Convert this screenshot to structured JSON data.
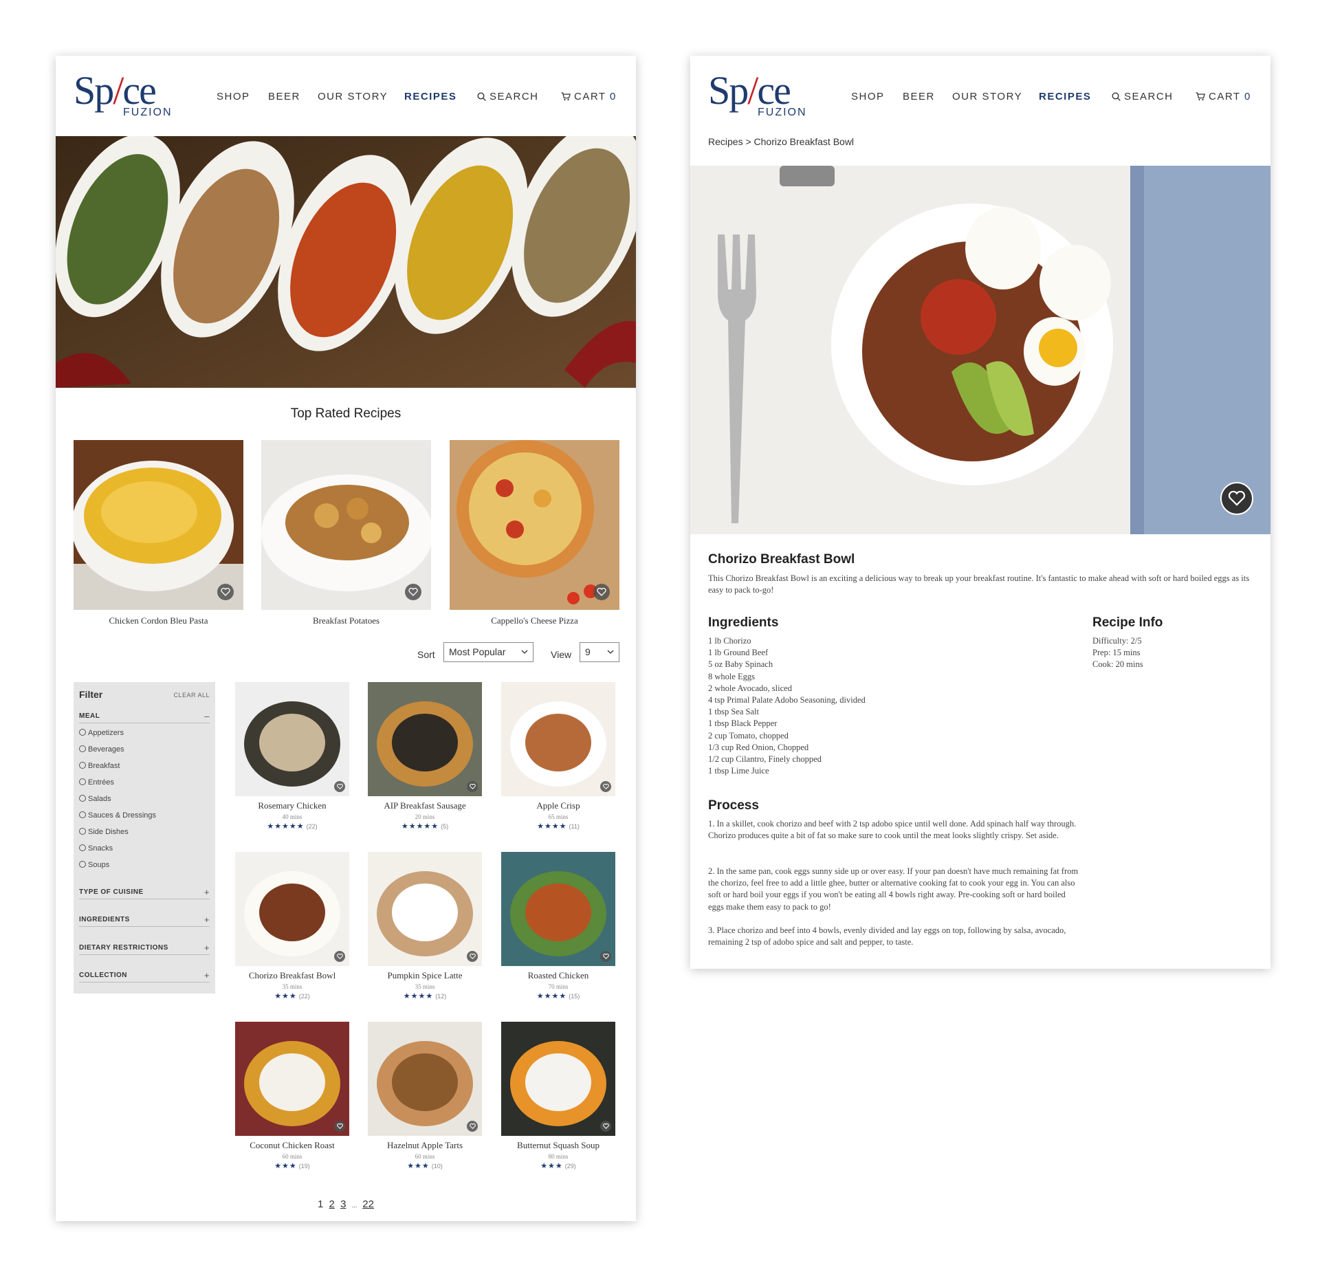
{
  "brand": {
    "logo_word": "Spice",
    "logo_sub": "FUZION",
    "color_primary": "#1f3b6e",
    "color_accent": "#c8232a"
  },
  "nav": {
    "shop": "SHOP",
    "beer": "BEER",
    "our_story": "OUR STORY",
    "recipes": "RECIPES",
    "search": "SEARCH",
    "cart": "CART",
    "cart_count": "0"
  },
  "listing": {
    "section_title": "Top Rated Recipes",
    "top_rated": [
      {
        "name": "Chicken Cordon Bleu Pasta",
        "icon": "heart-icon"
      },
      {
        "name": "Breakfast Potatoes",
        "icon": "heart-icon"
      },
      {
        "name": "Cappello's Cheese Pizza",
        "icon": "heart-icon"
      }
    ],
    "sort_label": "Sort",
    "sort_value": "Most Popular",
    "view_label": "View",
    "view_value": "9",
    "filter": {
      "title": "Filter",
      "clear": "CLEAR ALL",
      "meal_heading": "MEAL",
      "meal_options": [
        "Appetizers",
        "Beverages",
        "Breakfast",
        "Entrées",
        "Salads",
        "Sauces & Dressings",
        "Side Dishes",
        "Snacks",
        "Soups"
      ],
      "other_headings": [
        "TYPE OF CUISINE",
        "INGREDIENTS",
        "DIETARY RESTRICTIONS",
        "COLLECTION"
      ]
    },
    "recipes": [
      {
        "name": "Rosemary Chicken",
        "time": "40 mins",
        "stars": 5,
        "count": "(22)"
      },
      {
        "name": "AIP Breakfast Sausage",
        "time": "20 mins",
        "stars": 5,
        "count": "(5)"
      },
      {
        "name": "Apple Crisp",
        "time": "65 mins",
        "stars": 4,
        "count": "(11)"
      },
      {
        "name": "Chorizo Breakfast Bowl",
        "time": "35 mins",
        "stars": 3,
        "count": "(22)"
      },
      {
        "name": "Pumpkin Spice Latte",
        "time": "35 mins",
        "stars": 4,
        "count": "(12)"
      },
      {
        "name": "Roasted Chicken",
        "time": "70 mins",
        "stars": 4,
        "count": "(15)"
      },
      {
        "name": "Coconut Chicken Roast",
        "time": "60 mins",
        "stars": 3,
        "count": "(19)"
      },
      {
        "name": "Hazelnut Apple Tarts",
        "time": "60 mins",
        "stars": 3,
        "count": "(10)"
      },
      {
        "name": "Butternut Squash Soup",
        "time": "80 mins",
        "stars": 3,
        "count": "(29)"
      }
    ],
    "pagination": {
      "p1": "1",
      "p2": "2",
      "p3": "3",
      "ellipsis": "...",
      "last": "22"
    }
  },
  "detail": {
    "breadcrumb": "Recipes > Chorizo Breakfast Bowl",
    "title": "Chorizo Breakfast Bowl",
    "description": "This Chorizo Breakfast Bowl is an exciting a delicious way to break up your breakfast routine. It's fantastic to make ahead with soft or hard boiled eggs as its easy to pack to-go!",
    "ingredients_heading": "Ingredients",
    "ingredients": [
      "1 lb Chorizo",
      "1 lb Ground Beef",
      "5 oz Baby Spinach",
      "8 whole Eggs",
      "2 whole Avocado, sliced",
      "4 tsp Primal Palate Adobo Seasoning, divided",
      "1 tbsp Sea Salt",
      "1 tbsp Black Pepper",
      "2 cup Tomato, chopped",
      "1/3 cup Red Onion, Chopped",
      "1/2 cup Cilantro, Finely chopped",
      "1 tbsp Lime Juice"
    ],
    "info_heading": "Recipe Info",
    "info": [
      "Difficulty: 2/5",
      "Prep: 15 mins",
      "Cook: 20 mins"
    ],
    "process_heading": "Process",
    "process": [
      "1. In a skillet, cook chorizo and beef with 2 tsp adobo spice until well done. Add spinach half way through. Chorizo produces quite a bit of fat so make sure to cook until the meat looks slightly crispy. Set aside.",
      "2. In the same pan, cook eggs sunny side up or over easy. If your pan doesn't have much remaining fat from the chorizo, feel free to add a little ghee, butter or alternative cooking fat to cook your egg in. You can also soft or hard boil your eggs if you won't be eating all 4 bowls right away. Pre-cooking soft or hard boiled eggs make them easy to pack to go!",
      "3. Place chorizo and beef into 4 bowls, evenly divided and lay eggs on top, following by salsa, avocado, remaining 2 tsp of adobo spice and salt and pepper, to taste."
    ]
  }
}
